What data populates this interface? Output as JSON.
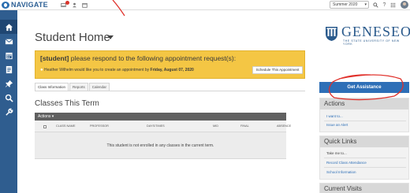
{
  "app": {
    "name": "NAVIGATE"
  },
  "topbar": {
    "term": "Summer 2020",
    "colors": {
      "brand": "#2c5f94",
      "badge": "#d9342b"
    }
  },
  "sidebar": {
    "items": [
      {
        "icon": "home-icon"
      },
      {
        "icon": "mail-icon"
      },
      {
        "icon": "calendar-icon"
      },
      {
        "icon": "reports-icon"
      },
      {
        "icon": "pin-icon"
      },
      {
        "icon": "search-icon"
      },
      {
        "icon": "tools-icon"
      }
    ]
  },
  "page": {
    "title": "Student Home"
  },
  "brand_logo": {
    "name": "GENESEO",
    "subtitle": "THE STATE UNIVERSITY OF NEW YORK"
  },
  "alert": {
    "tag": "[student]",
    "message": "please respond to the following appointment request(s):",
    "line_prefix": "Heather Wilhelm would like you to create an appointment by",
    "line_date": "Friday, August 07, 2020",
    "button": "Schedule This Appointment"
  },
  "tabs": [
    {
      "label": "Class Information",
      "active": true
    },
    {
      "label": "Reports",
      "active": false
    },
    {
      "label": "Calendar",
      "active": false
    }
  ],
  "classes": {
    "title": "Classes This Term",
    "actions_label": "Actions ▾",
    "columns": [
      "CLASS NAME",
      "PROFESSOR",
      "DAYS/TIMES",
      "MID",
      "FINAL",
      "ABSENCE"
    ],
    "empty_message": "This student is not enrolled in any classes in the current term."
  },
  "right": {
    "assist_button": "Get Assistance",
    "actions_panel": {
      "title": "Actions",
      "lines": [
        "I want to...",
        "Issue an Alert"
      ]
    },
    "quick_links": {
      "title": "Quick Links",
      "lines": [
        "Take me to...",
        "Record Class Attendance",
        "School Information"
      ]
    },
    "current_visits": {
      "title": "Current Visits"
    }
  }
}
